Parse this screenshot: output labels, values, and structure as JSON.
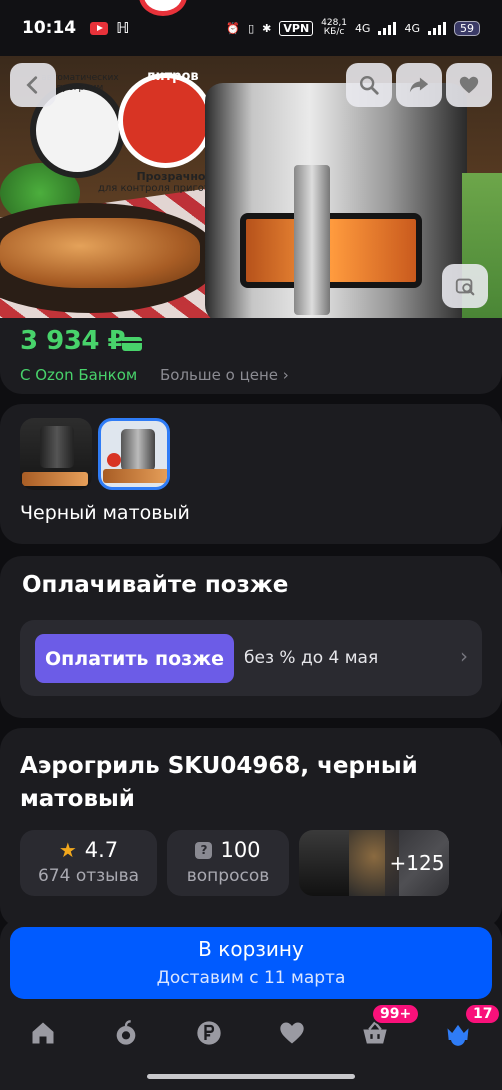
{
  "status_bar": {
    "time": "10:14",
    "vpn": "VPN",
    "net_speed_value": "428,1",
    "net_speed_unit": "КБ/с",
    "network_1": "4G",
    "network_2": "4G",
    "battery": "59"
  },
  "hero": {
    "badge_text": "автоматических программ",
    "liters_text": "литров",
    "window_title": "Прозрачное окно",
    "window_sub": "для контроля приготовления пищи"
  },
  "price": {
    "value": "3 934 ₽",
    "bank_label": "С Ozon Банком",
    "more_label": "Больше о цене ›"
  },
  "variant": {
    "color_name": "Черный матовый"
  },
  "pay_later": {
    "title": "Оплачивайте позже",
    "button_label": "Оплатить позже",
    "subtitle": "без % до 4 мая"
  },
  "product": {
    "title": "Аэрогриль SKU04968, черный матовый",
    "rating": "4.7",
    "reviews": "674 отзыва",
    "questions_count": "100",
    "questions_label": "вопросов",
    "photos_more": "+125"
  },
  "cart": {
    "label": "В корзину",
    "delivery": "Доставим с 11 марта"
  },
  "nav": {
    "favorites_badge": "99+",
    "profile_badge": "17"
  },
  "colors": {
    "accent_green": "#48d36b",
    "cart_blue": "#005bff",
    "pay_purple": "#6c5ce7",
    "badge_pink": "#f9117a"
  }
}
